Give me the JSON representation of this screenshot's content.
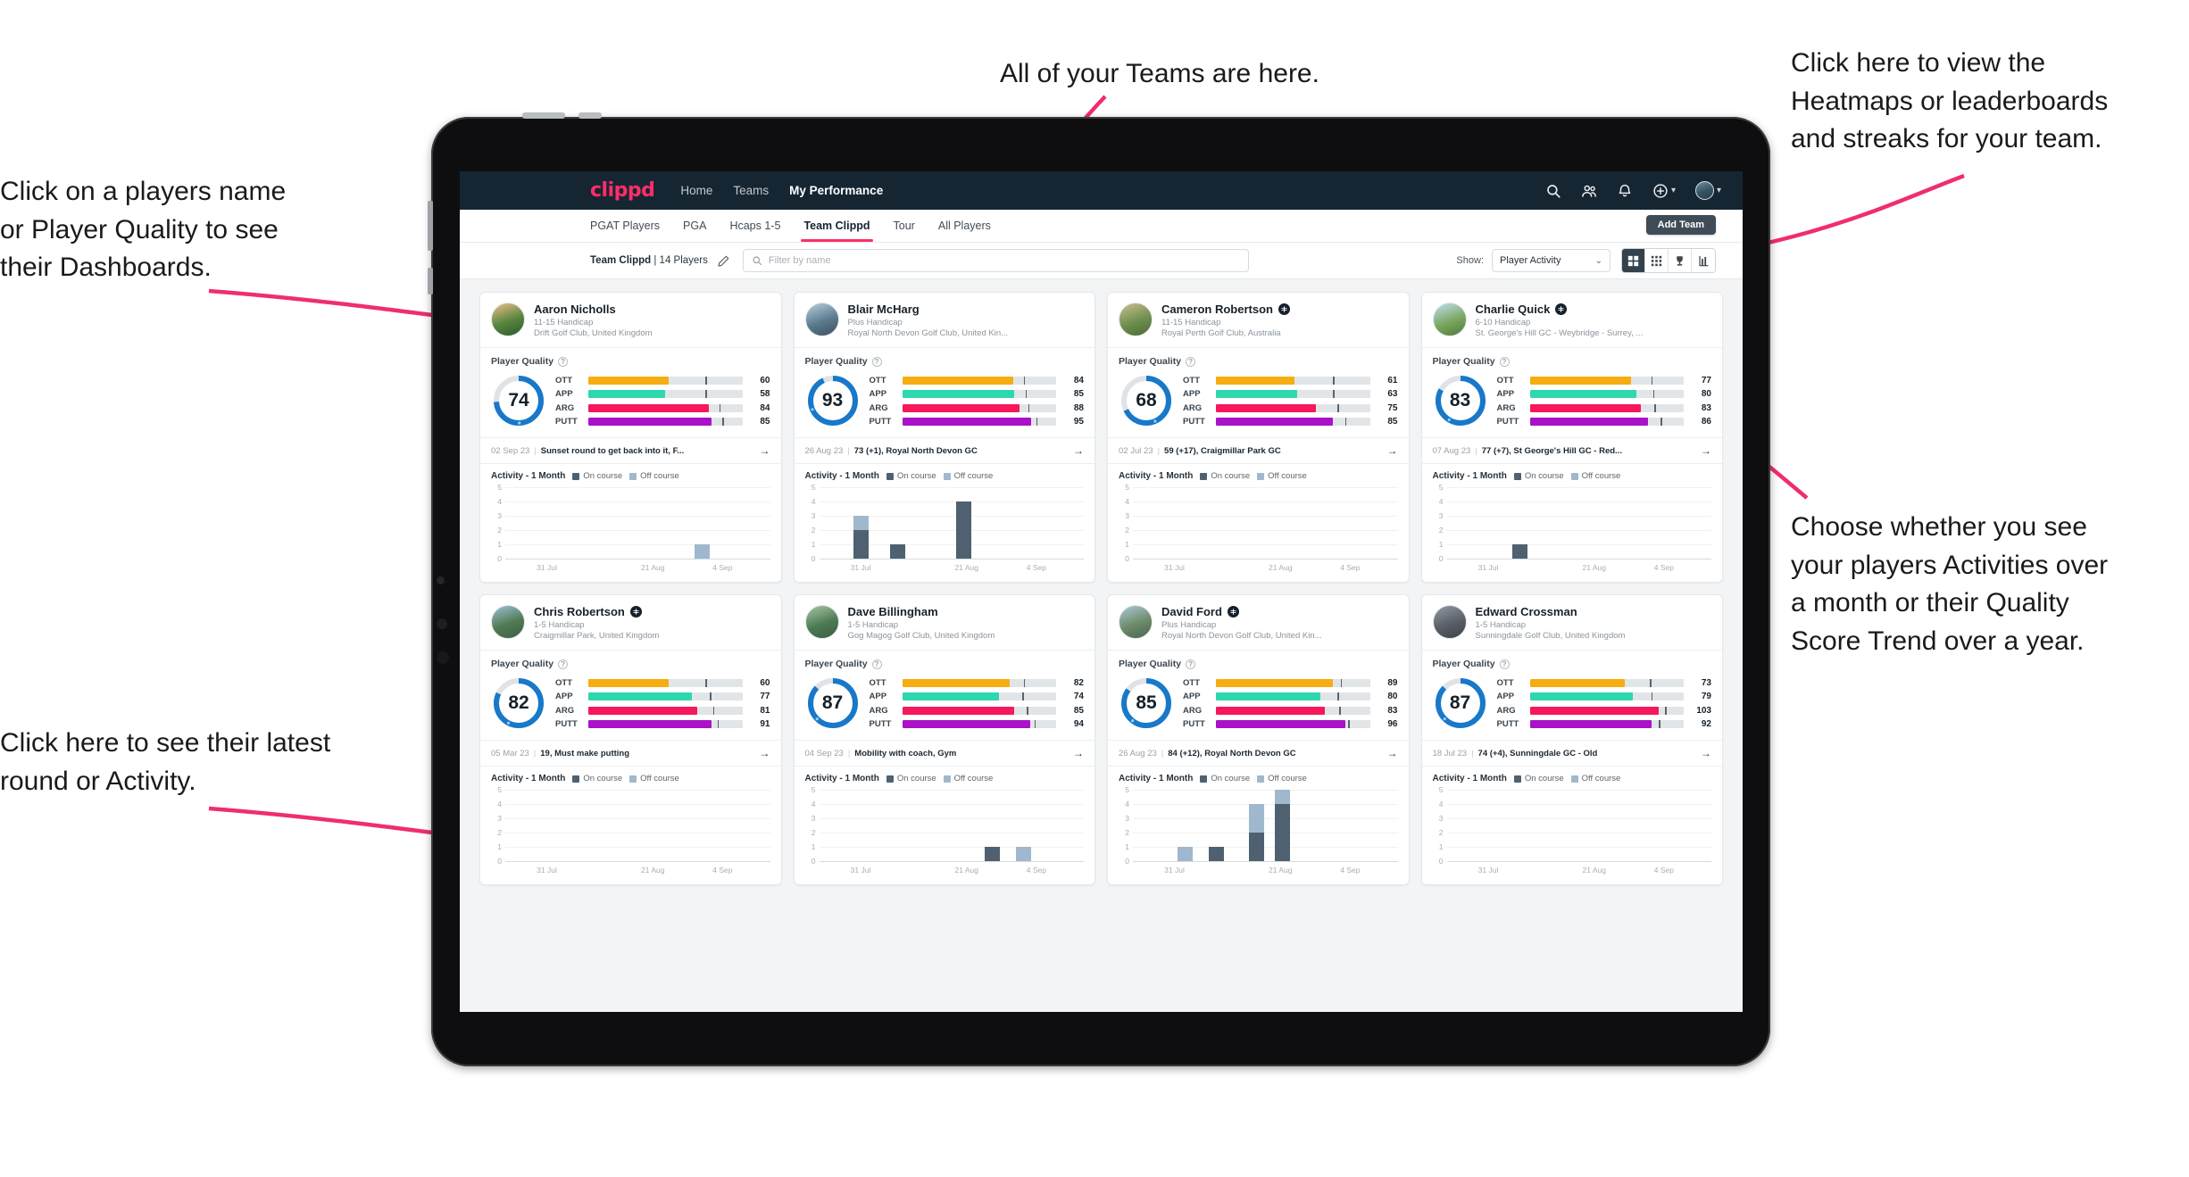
{
  "annotations": [
    {
      "id": "a-teams",
      "text": "All of your Teams are here."
    },
    {
      "id": "a-heatmap",
      "text": "Click here to view the\nHeatmaps or leaderboards\nand streaks for your team."
    },
    {
      "id": "a-names",
      "text": "Click on a players name\nor Player Quality to see\ntheir Dashboards."
    },
    {
      "id": "a-choose",
      "text": "Choose whether you see\nyour players Activities over\na month or their Quality\nScore Trend over a year."
    },
    {
      "id": "a-latest",
      "text": "Click here to see their latest\nround or Activity."
    }
  ],
  "topnav": {
    "brand": "clippd",
    "links": [
      {
        "label": "Home",
        "active": false
      },
      {
        "label": "Teams",
        "active": false
      },
      {
        "label": "My Performance",
        "active": true
      }
    ],
    "icons": [
      "search-icon",
      "people-icon",
      "bell-icon",
      "plus-circle-icon",
      "avatar"
    ]
  },
  "subtabs": {
    "tabs": [
      {
        "label": "PGAT Players",
        "active": false
      },
      {
        "label": "PGA",
        "active": false
      },
      {
        "label": "Hcaps 1-5",
        "active": false
      },
      {
        "label": "Team Clippd",
        "active": true
      },
      {
        "label": "Tour",
        "active": false
      },
      {
        "label": "All Players",
        "active": false
      }
    ],
    "add_team_label": "Add Team"
  },
  "toolbar": {
    "team_name": "Team Clippd",
    "team_count": "| 14 Players",
    "edit_icon": "pencil-icon",
    "search_placeholder": "Filter by name",
    "show_label": "Show:",
    "show_value": "Player Activity",
    "views": [
      {
        "name": "grid-large-view",
        "active": true
      },
      {
        "name": "grid-small-view",
        "active": false
      },
      {
        "name": "trophy-view",
        "active": false
      },
      {
        "name": "heatmap-view",
        "active": false
      }
    ]
  },
  "chart_common": {
    "legend": [
      "On course",
      "Off course"
    ],
    "activity_title": "Activity - 1 Month",
    "yticks": [
      "5",
      "4",
      "3",
      "2",
      "1",
      "0"
    ],
    "xticks": [
      "31 Jul",
      "21 Aug",
      "4 Sep"
    ],
    "colors": {
      "on_course": "#4f6170",
      "off_course": "#9fb8cd"
    }
  },
  "metric_colors": {
    "OTT": "#f6ad11",
    "APP": "#2ed7ad",
    "ARG": "#f5185b",
    "PUTT": "#a912c8"
  },
  "section_labels": {
    "player_quality": "Player Quality"
  },
  "players": [
    {
      "name": "Aaron Nicholls",
      "verified": false,
      "handicap": "11-15 Handicap",
      "club": "Drift Golf Club, United Kingdom",
      "quality": 74,
      "metrics": [
        {
          "label": "OTT",
          "value": 60,
          "fill": 52,
          "tick": 76
        },
        {
          "label": "APP",
          "value": 58,
          "fill": 50,
          "tick": 76
        },
        {
          "label": "ARG",
          "value": 84,
          "fill": 78,
          "tick": 85
        },
        {
          "label": "PUTT",
          "value": 85,
          "fill": 80,
          "tick": 87
        }
      ],
      "round": {
        "date": "02 Sep 23",
        "desc": "Sunset round to get back into it, F..."
      },
      "chart_data": {
        "type": "bar",
        "title": "Activity - 1 Month",
        "categories": [
          "31 Jul",
          "21 Aug",
          "4 Sep"
        ],
        "ylim": [
          0,
          5
        ],
        "series": [
          {
            "name": "On course",
            "values": []
          },
          {
            "name": "Off course",
            "values": []
          }
        ],
        "bars": [
          {
            "x": 72,
            "on": 0,
            "off": 1
          }
        ]
      }
    },
    {
      "name": "Blair McHarg",
      "verified": false,
      "handicap": "Plus Handicap",
      "club": "Royal North Devon Golf Club, United Kin...",
      "quality": 93,
      "metrics": [
        {
          "label": "OTT",
          "value": 84,
          "fill": 72,
          "tick": 79
        },
        {
          "label": "APP",
          "value": 85,
          "fill": 73,
          "tick": 80
        },
        {
          "label": "ARG",
          "value": 88,
          "fill": 76,
          "tick": 82
        },
        {
          "label": "PUTT",
          "value": 95,
          "fill": 84,
          "tick": 87
        }
      ],
      "round": {
        "date": "26 Aug 23",
        "desc": "73 (+1), Royal North Devon GC"
      },
      "chart_data": {
        "type": "bar",
        "title": "Activity - 1 Month",
        "categories": [
          "31 Jul",
          "21 Aug",
          "4 Sep"
        ],
        "ylim": [
          0,
          5
        ],
        "bars": [
          {
            "x": 13,
            "on": 2,
            "off": 1
          },
          {
            "x": 27,
            "on": 1,
            "off": 0
          },
          {
            "x": 52,
            "on": 4,
            "off": 0
          }
        ]
      }
    },
    {
      "name": "Cameron Robertson",
      "verified": true,
      "handicap": "11-15 Handicap",
      "club": "Royal Perth Golf Club, Australia",
      "quality": 68,
      "metrics": [
        {
          "label": "OTT",
          "value": 61,
          "fill": 51,
          "tick": 76
        },
        {
          "label": "APP",
          "value": 63,
          "fill": 53,
          "tick": 76
        },
        {
          "label": "ARG",
          "value": 75,
          "fill": 65,
          "tick": 79
        },
        {
          "label": "PUTT",
          "value": 85,
          "fill": 76,
          "tick": 84
        }
      ],
      "round": {
        "date": "02 Jul 23",
        "desc": "59 (+17), Craigmillar Park GC"
      },
      "chart_data": {
        "type": "bar",
        "title": "Activity - 1 Month",
        "categories": [
          "31 Jul",
          "21 Aug",
          "4 Sep"
        ],
        "ylim": [
          0,
          5
        ],
        "bars": []
      }
    },
    {
      "name": "Charlie Quick",
      "verified": true,
      "handicap": "6-10 Handicap",
      "club": "St. George's Hill GC - Weybridge - Surrey, ...",
      "quality": 83,
      "metrics": [
        {
          "label": "OTT",
          "value": 77,
          "fill": 66,
          "tick": 79
        },
        {
          "label": "APP",
          "value": 80,
          "fill": 69,
          "tick": 80
        },
        {
          "label": "ARG",
          "value": 83,
          "fill": 72,
          "tick": 81
        },
        {
          "label": "PUTT",
          "value": 86,
          "fill": 77,
          "tick": 85
        }
      ],
      "round": {
        "date": "07 Aug 23",
        "desc": "77 (+7), St George's Hill GC - Red..."
      },
      "chart_data": {
        "type": "bar",
        "title": "Activity - 1 Month",
        "categories": [
          "31 Jul",
          "21 Aug",
          "4 Sep"
        ],
        "ylim": [
          0,
          5
        ],
        "bars": [
          {
            "x": 25,
            "on": 1,
            "off": 0
          }
        ]
      }
    },
    {
      "name": "Chris Robertson",
      "verified": true,
      "handicap": "1-5 Handicap",
      "club": "Craigmillar Park, United Kingdom",
      "quality": 82,
      "metrics": [
        {
          "label": "OTT",
          "value": 60,
          "fill": 52,
          "tick": 76
        },
        {
          "label": "APP",
          "value": 77,
          "fill": 67,
          "tick": 79
        },
        {
          "label": "ARG",
          "value": 81,
          "fill": 71,
          "tick": 81
        },
        {
          "label": "PUTT",
          "value": 91,
          "fill": 80,
          "tick": 84
        }
      ],
      "round": {
        "date": "05 Mar 23",
        "desc": "19, Must make putting"
      },
      "chart_data": {
        "type": "bar",
        "title": "Activity - 1 Month",
        "categories": [
          "31 Jul",
          "21 Aug",
          "4 Sep"
        ],
        "ylim": [
          0,
          5
        ],
        "bars": []
      }
    },
    {
      "name": "Dave Billingham",
      "verified": false,
      "handicap": "1-5 Handicap",
      "club": "Gog Magog Golf Club, United Kingdom",
      "quality": 87,
      "metrics": [
        {
          "label": "OTT",
          "value": 82,
          "fill": 70,
          "tick": 79
        },
        {
          "label": "APP",
          "value": 74,
          "fill": 63,
          "tick": 78
        },
        {
          "label": "ARG",
          "value": 85,
          "fill": 73,
          "tick": 81
        },
        {
          "label": "PUTT",
          "value": 94,
          "fill": 83,
          "tick": 86
        }
      ],
      "round": {
        "date": "04 Sep 23",
        "desc": "Mobility with coach, Gym"
      },
      "chart_data": {
        "type": "bar",
        "title": "Activity - 1 Month",
        "categories": [
          "31 Jul",
          "21 Aug",
          "4 Sep"
        ],
        "ylim": [
          0,
          5
        ],
        "bars": [
          {
            "x": 63,
            "on": 1,
            "off": 0
          },
          {
            "x": 75,
            "on": 0,
            "off": 1
          }
        ]
      }
    },
    {
      "name": "David Ford",
      "verified": true,
      "handicap": "Plus Handicap",
      "club": "Royal North Devon Golf Club, United Kin...",
      "quality": 85,
      "metrics": [
        {
          "label": "OTT",
          "value": 89,
          "fill": 76,
          "tick": 81
        },
        {
          "label": "APP",
          "value": 80,
          "fill": 68,
          "tick": 79
        },
        {
          "label": "ARG",
          "value": 83,
          "fill": 71,
          "tick": 80
        },
        {
          "label": "PUTT",
          "value": 96,
          "fill": 84,
          "tick": 86
        }
      ],
      "round": {
        "date": "26 Aug 23",
        "desc": "84 (+12), Royal North Devon GC"
      },
      "chart_data": {
        "type": "bar",
        "title": "Activity - 1 Month",
        "categories": [
          "31 Jul",
          "21 Aug",
          "4 Sep"
        ],
        "ylim": [
          0,
          5
        ],
        "bars": [
          {
            "x": 17,
            "on": 0,
            "off": 1
          },
          {
            "x": 29,
            "on": 1,
            "off": 0
          },
          {
            "x": 44,
            "on": 2,
            "off": 2
          },
          {
            "x": 54,
            "on": 4,
            "off": 1
          }
        ]
      }
    },
    {
      "name": "Edward Crossman",
      "verified": false,
      "handicap": "1-5 Handicap",
      "club": "Sunningdale Golf Club, United Kingdom",
      "quality": 87,
      "metrics": [
        {
          "label": "OTT",
          "value": 73,
          "fill": 62,
          "tick": 78
        },
        {
          "label": "APP",
          "value": 79,
          "fill": 67,
          "tick": 79
        },
        {
          "label": "ARG",
          "value": 103,
          "fill": 84,
          "tick": 88
        },
        {
          "label": "PUTT",
          "value": 92,
          "fill": 79,
          "tick": 84
        }
      ],
      "round": {
        "date": "18 Jul 23",
        "desc": "74 (+4), Sunningdale GC - Old"
      },
      "chart_data": {
        "type": "bar",
        "title": "Activity - 1 Month",
        "categories": [
          "31 Jul",
          "21 Aug",
          "4 Sep"
        ],
        "ylim": [
          0,
          5
        ],
        "bars": []
      }
    }
  ]
}
